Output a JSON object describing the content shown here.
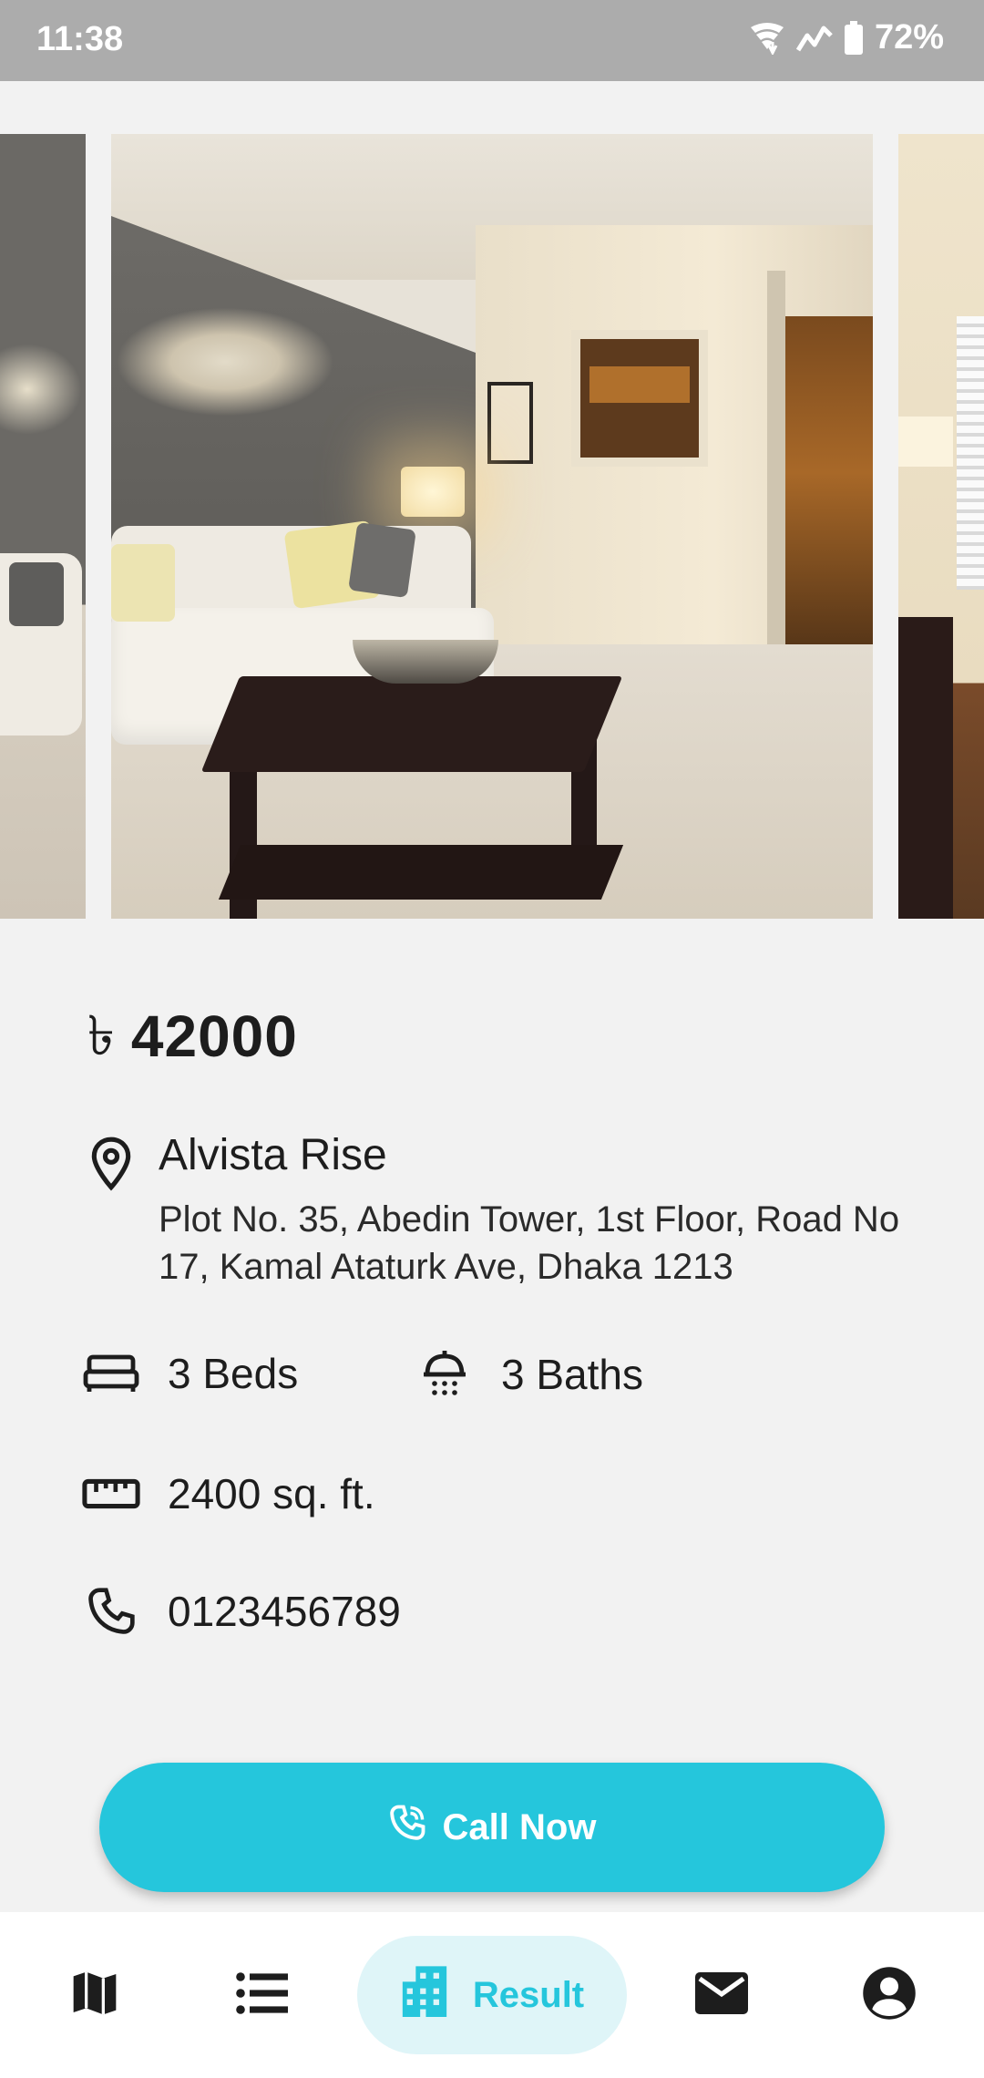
{
  "status_bar": {
    "time": "11:38",
    "battery": "72%",
    "icons": [
      "wifi-icon",
      "signal-icon",
      "battery-icon"
    ]
  },
  "gallery": {
    "images": [
      "living-room-photo-1",
      "living-room-photo-2",
      "living-room-photo-3"
    ]
  },
  "listing": {
    "currency_symbol": "৳",
    "price": "42000",
    "name": "Alvista Rise",
    "address": "Plot No. 35, Abedin Tower, 1st Floor, Road No 17, Kamal Ataturk Ave, Dhaka 1213",
    "beds": "3 Beds",
    "baths": "3 Baths",
    "area": "2400 sq. ft.",
    "phone": "0123456789"
  },
  "actions": {
    "call_label": "Call Now"
  },
  "bottom_nav": {
    "items": [
      {
        "icon": "map-icon",
        "label": ""
      },
      {
        "icon": "list-icon",
        "label": ""
      },
      {
        "icon": "building-icon",
        "label": "Result",
        "active": true
      },
      {
        "icon": "mail-icon",
        "label": ""
      },
      {
        "icon": "account-icon",
        "label": ""
      }
    ]
  },
  "colors": {
    "accent": "#25c6dc",
    "accent_soft": "#dff5f8",
    "background": "#f2f2f2",
    "status_bar": "#acacac"
  }
}
